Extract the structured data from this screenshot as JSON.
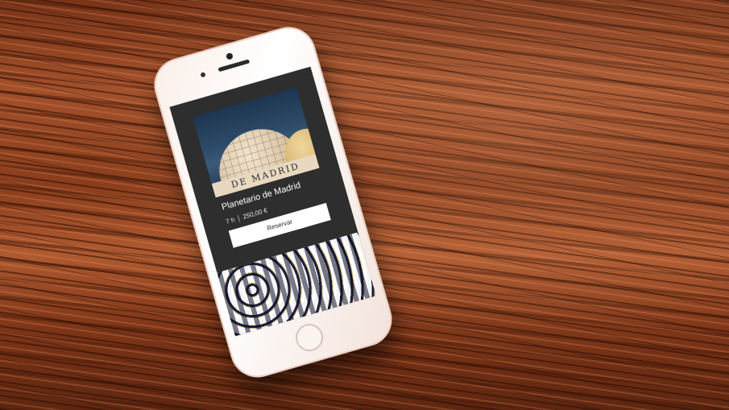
{
  "card": {
    "hero_sign_text": "DE MADRID",
    "title": "Planetario de Madrid",
    "duration": "7 h",
    "price": "250,00 €",
    "reserve_label": "Reservar"
  },
  "colors": {
    "screen_background": "#2e2e2e",
    "button_background": "#ffffff",
    "title_text": "#ffffff",
    "phone_body": "#fbeee8",
    "wood_background": "#8a3d1c"
  },
  "icons": {
    "home_button": "home-button-icon",
    "camera": "front-camera-icon",
    "speaker": "speaker-icon"
  }
}
